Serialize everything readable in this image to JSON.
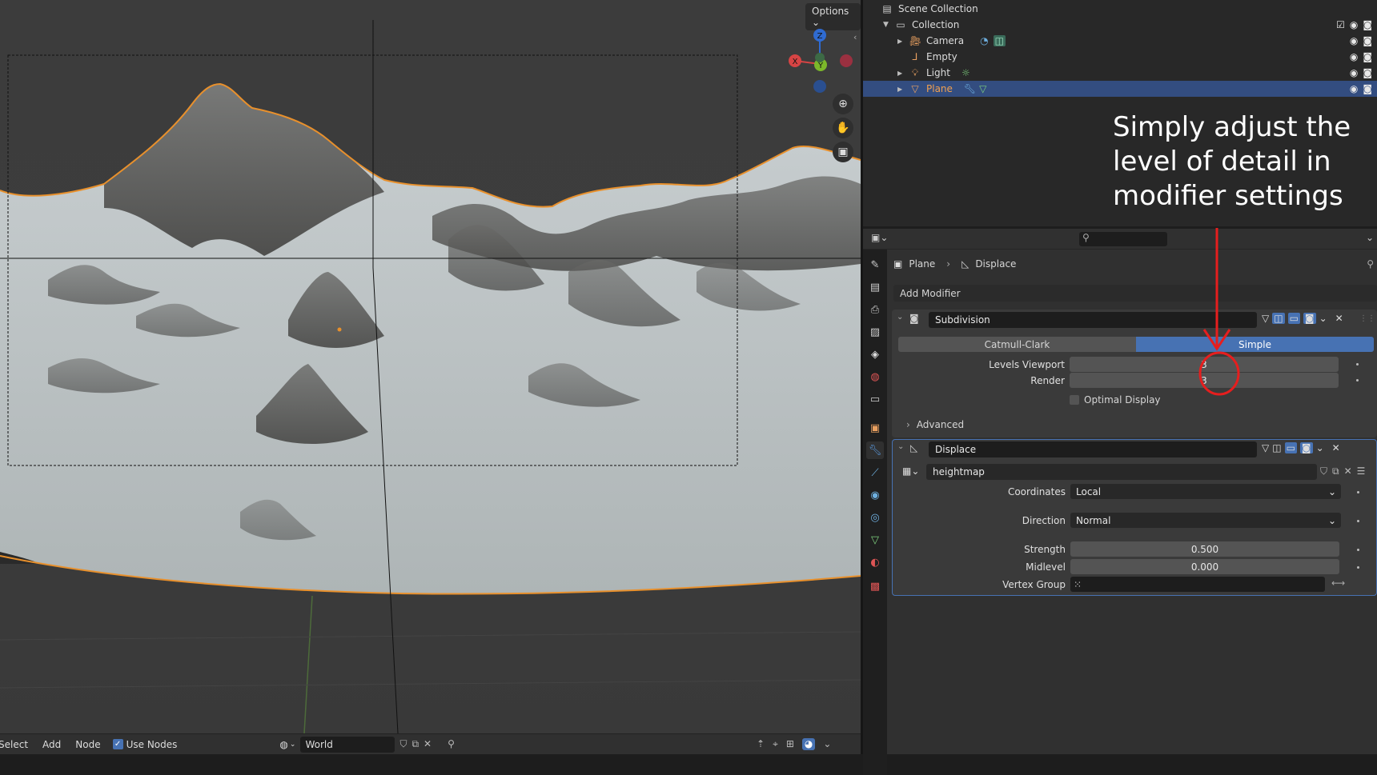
{
  "viewport": {
    "options_label": "Options",
    "gizmo": {
      "z": "Z",
      "x": "X",
      "y": "Y"
    }
  },
  "bottom_bar": {
    "menu": [
      "Select",
      "Add",
      "Node"
    ],
    "use_nodes_label": "Use Nodes",
    "use_nodes_checked": true,
    "world_name": "World"
  },
  "outliner": {
    "root": "Scene Collection",
    "collection": "Collection",
    "items": [
      {
        "label": "Camera",
        "icon": "camera-icon",
        "color": "#e9a060"
      },
      {
        "label": "Empty",
        "icon": "empty-icon",
        "color": "#e9a060"
      },
      {
        "label": "Light",
        "icon": "light-icon",
        "color": "#e9a060"
      },
      {
        "label": "Plane",
        "icon": "mesh-icon",
        "color": "#e9a060",
        "selected": true
      }
    ],
    "selected_color": "#334d80"
  },
  "annotation": {
    "text": "Simply adjust the\nlevel of detail in\nmodifier settings",
    "color": "#e61e1e"
  },
  "properties": {
    "breadcrumb": {
      "object": "Plane",
      "modifier": "Displace"
    },
    "add_modifier_label": "Add Modifier",
    "subdivision": {
      "name": "Subdivision",
      "types": [
        "Catmull-Clark",
        "Simple"
      ],
      "active_type": "Simple",
      "levels_viewport_label": "Levels Viewport",
      "levels_viewport": "3",
      "render_label": "Render",
      "render": "3",
      "optimal_display_label": "Optimal Display",
      "advanced_label": "Advanced"
    },
    "displace": {
      "name": "Displace",
      "texture": "heightmap",
      "coordinates_label": "Coordinates",
      "coordinates": "Local",
      "direction_label": "Direction",
      "direction": "Normal",
      "strength_label": "Strength",
      "strength": "0.500",
      "midlevel_label": "Midlevel",
      "midlevel": "0.000",
      "vertex_group_label": "Vertex Group"
    },
    "accent": "#4772b3"
  }
}
